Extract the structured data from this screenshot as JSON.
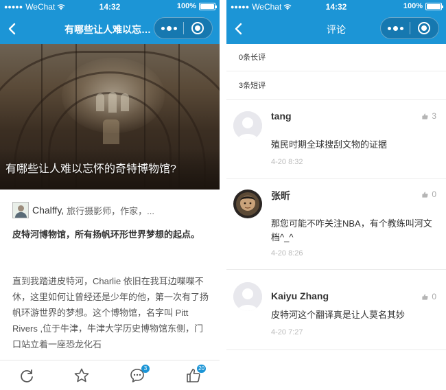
{
  "status_bar": {
    "carrier": "WeChat",
    "time": "14:32",
    "battery": "100%"
  },
  "left": {
    "nav_title": "有哪些让人难以忘怀...",
    "hero_title": "有哪些让人难以忘怀的奇特博物馆?",
    "author": {
      "name": "Chalffy,",
      "bio": "旅行摄影师，作家，..."
    },
    "lead_text": "皮特河博物馆，所有扬帆环形世界梦想的起点。",
    "body_text": "直到我踏进皮特河，Charlie 依旧在我耳边喋喋不休，这里如何让曾经还是少年的他，第一次有了扬帆环游世界的梦想。这个博物馆，名字叫 Pitt Rivers ,位于牛津，牛津大学历史博物馆东侧，门口站立着一座恐龙化石",
    "tabbar": {
      "comment_badge": "3",
      "like_badge": "20"
    }
  },
  "right": {
    "nav_title": "评论",
    "long_comments": "0条长评",
    "short_comments": "3条短评",
    "comments": [
      {
        "name": "tang",
        "likes": "3",
        "text": "殖民时期全球搜刮文物的证据",
        "time": "4-20 8:32"
      },
      {
        "name": "张昕",
        "likes": "0",
        "text": "那您可能不咋关注NBA，有个教练叫河文档^_^",
        "time": "4-20 8:26"
      },
      {
        "name": "Kaiyu Zhang",
        "likes": "0",
        "text": "皮特河这个翻译真是让人莫名其妙",
        "time": "4-20 7:27"
      }
    ]
  },
  "colors": {
    "brand": "#1c95d6",
    "capsule": "#1678b0"
  }
}
